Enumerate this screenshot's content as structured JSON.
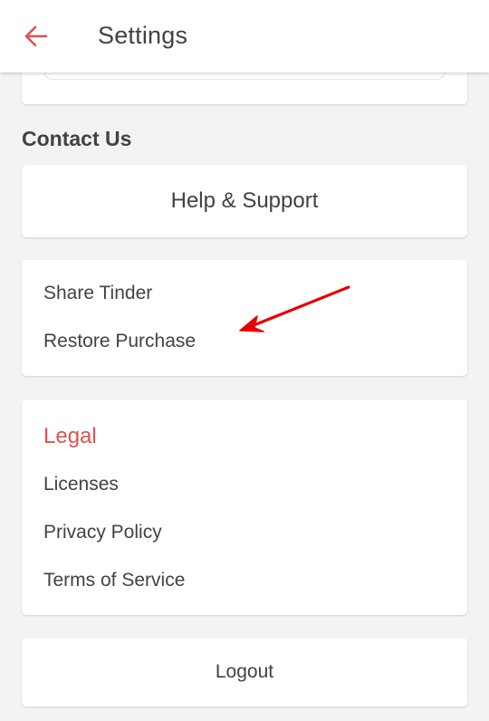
{
  "app_bar": {
    "title": "Settings",
    "back_icon": "arrow-left-icon",
    "accent_color": "#e0504f"
  },
  "contact": {
    "header": "Contact Us",
    "help_label": "Help & Support"
  },
  "misc": {
    "items": [
      "Share Tinder",
      "Restore Purchase"
    ]
  },
  "legal": {
    "title": "Legal",
    "items": [
      "Licenses",
      "Privacy Policy",
      "Terms of Service"
    ]
  },
  "logout": {
    "label": "Logout"
  },
  "annotation": {
    "icon": "red-arrow-icon",
    "color": "#e60000"
  }
}
